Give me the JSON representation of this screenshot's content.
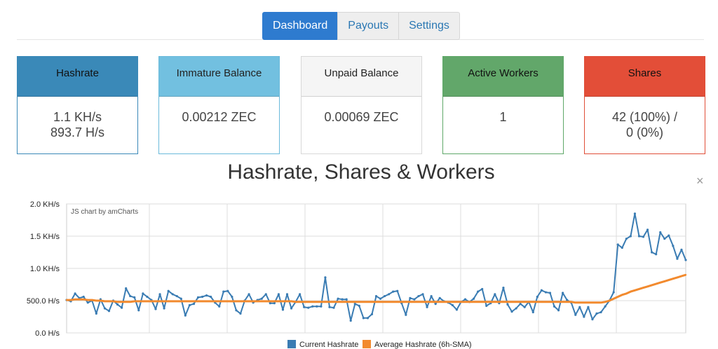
{
  "tabs": [
    {
      "label": "Dashboard",
      "active": true
    },
    {
      "label": "Payouts",
      "active": false
    },
    {
      "label": "Settings",
      "active": false
    }
  ],
  "stats": [
    {
      "title": "Hashrate",
      "lines": [
        "1.1 KH/s",
        "893.7 H/s"
      ]
    },
    {
      "title": "Immature Balance",
      "lines": [
        "0.00212 ZEC"
      ]
    },
    {
      "title": "Unpaid Balance",
      "lines": [
        "0.00069 ZEC"
      ]
    },
    {
      "title": "Active Workers",
      "lines": [
        "1"
      ]
    },
    {
      "title": "Shares",
      "lines": [
        "42 (100%) /",
        "0 (0%)"
      ]
    }
  ],
  "chart_title": "Hashrate, Shares & Workers",
  "close_glyph": "×",
  "chart_data": {
    "type": "line",
    "watermark": "JS chart by amCharts",
    "y_ticks": [
      {
        "value": 0,
        "label": "0.0 H/s"
      },
      {
        "value": 500,
        "label": "500.0 H/s"
      },
      {
        "value": 1000,
        "label": "1.0 KH/s"
      },
      {
        "value": 1500,
        "label": "1.5 KH/s"
      },
      {
        "value": 2000,
        "label": "2.0 KH/s"
      }
    ],
    "ylim": [
      0,
      2000
    ],
    "colors": {
      "current": "#3a7cb3",
      "average": "#f28a2e",
      "grid": "#dddddd"
    },
    "series": [
      {
        "name": "Current Hashrate",
        "values": [
          510,
          490,
          610,
          540,
          560,
          470,
          500,
          300,
          520,
          380,
          340,
          500,
          440,
          390,
          690,
          570,
          550,
          350,
          610,
          560,
          510,
          370,
          600,
          380,
          650,
          600,
          570,
          530,
          270,
          430,
          450,
          550,
          560,
          580,
          560,
          470,
          410,
          640,
          650,
          560,
          350,
          300,
          500,
          600,
          470,
          510,
          530,
          600,
          460,
          460,
          600,
          360,
          600,
          380,
          480,
          600,
          400,
          390,
          410,
          410,
          410,
          860,
          400,
          390,
          530,
          520,
          520,
          190,
          450,
          420,
          230,
          230,
          290,
          570,
          530,
          570,
          600,
          640,
          650,
          460,
          280,
          540,
          520,
          570,
          600,
          400,
          570,
          450,
          540,
          490,
          470,
          430,
          360,
          480,
          520,
          480,
          530,
          640,
          680,
          420,
          460,
          600,
          460,
          700,
          440,
          330,
          380,
          450,
          400,
          480,
          320,
          560,
          660,
          630,
          620,
          410,
          350,
          620,
          510,
          470,
          280,
          400,
          250,
          400,
          210,
          300,
          320,
          410,
          500,
          630,
          1370,
          1320,
          1460,
          1500,
          1850,
          1500,
          1490,
          1600,
          1250,
          1220,
          1560,
          1460,
          1510,
          1350,
          1150,
          1290,
          1130
        ],
        "show_markers": true
      },
      {
        "name": "Average Hashrate (6h-SMA)",
        "values": [
          510,
          510,
          520,
          520,
          520,
          510,
          510,
          500,
          500,
          490,
          490,
          490,
          480,
          480,
          480,
          480,
          490,
          490,
          490,
          490,
          490,
          490,
          490,
          490,
          490,
          490,
          490,
          490,
          490,
          490,
          490,
          490,
          490,
          490,
          490,
          490,
          490,
          490,
          490,
          490,
          490,
          490,
          490,
          490,
          490,
          490,
          490,
          490,
          490,
          490,
          490,
          490,
          490,
          490,
          480,
          480,
          480,
          480,
          480,
          480,
          480,
          480,
          480,
          480,
          480,
          480,
          480,
          480,
          480,
          480,
          480,
          480,
          480,
          480,
          480,
          480,
          480,
          480,
          480,
          480,
          480,
          480,
          480,
          480,
          480,
          480,
          480,
          480,
          480,
          480,
          480,
          480,
          480,
          480,
          480,
          480,
          480,
          480,
          480,
          480,
          480,
          480,
          480,
          480,
          480,
          480,
          480,
          480,
          480,
          480,
          480,
          480,
          480,
          480,
          480,
          480,
          480,
          480,
          480,
          480,
          470,
          470,
          470,
          470,
          470,
          470,
          470,
          480,
          500,
          530,
          560,
          590,
          610,
          640,
          660,
          680,
          700,
          720,
          740,
          760,
          780,
          800,
          820,
          840,
          860,
          880,
          900
        ],
        "show_markers": false
      }
    ],
    "legend": [
      {
        "label": "Current Hashrate",
        "color": "#3a7cb3"
      },
      {
        "label": "Average Hashrate (6h-SMA)",
        "color": "#f28a2e"
      }
    ]
  }
}
